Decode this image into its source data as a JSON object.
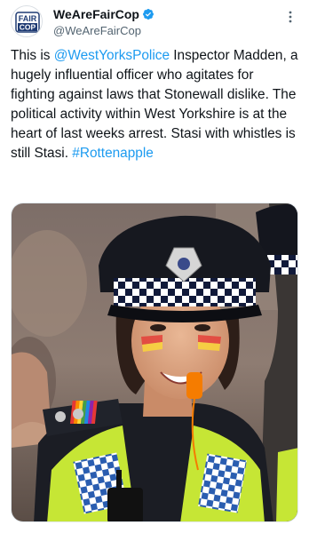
{
  "colors": {
    "link": "#1d9bf0",
    "verified_badge": "#1d9bf0",
    "text_primary": "#0f1419",
    "text_secondary": "#536471"
  },
  "tweet": {
    "author": {
      "display_name": "WeAreFairCop",
      "handle": "@WeAreFairCop",
      "verified": true,
      "avatar_text_top": "FAIR",
      "avatar_text_bottom": "COP"
    },
    "more_icon": "ellipsis-vertical-icon",
    "verified_icon": "verified-badge-icon",
    "text": {
      "part1": "This is ",
      "mention": "@WestYorksPolice",
      "part2": " Inspector Madden, a hugely influential officer who agitates for fighting against laws that Stonewall dislike. The political activity within West Yorkshire is at the heart of last weeks arrest. Stasi with whistles is still Stasi. ",
      "hashtag": "#Rottenapple"
    },
    "media": {
      "type": "photo"
    }
  }
}
